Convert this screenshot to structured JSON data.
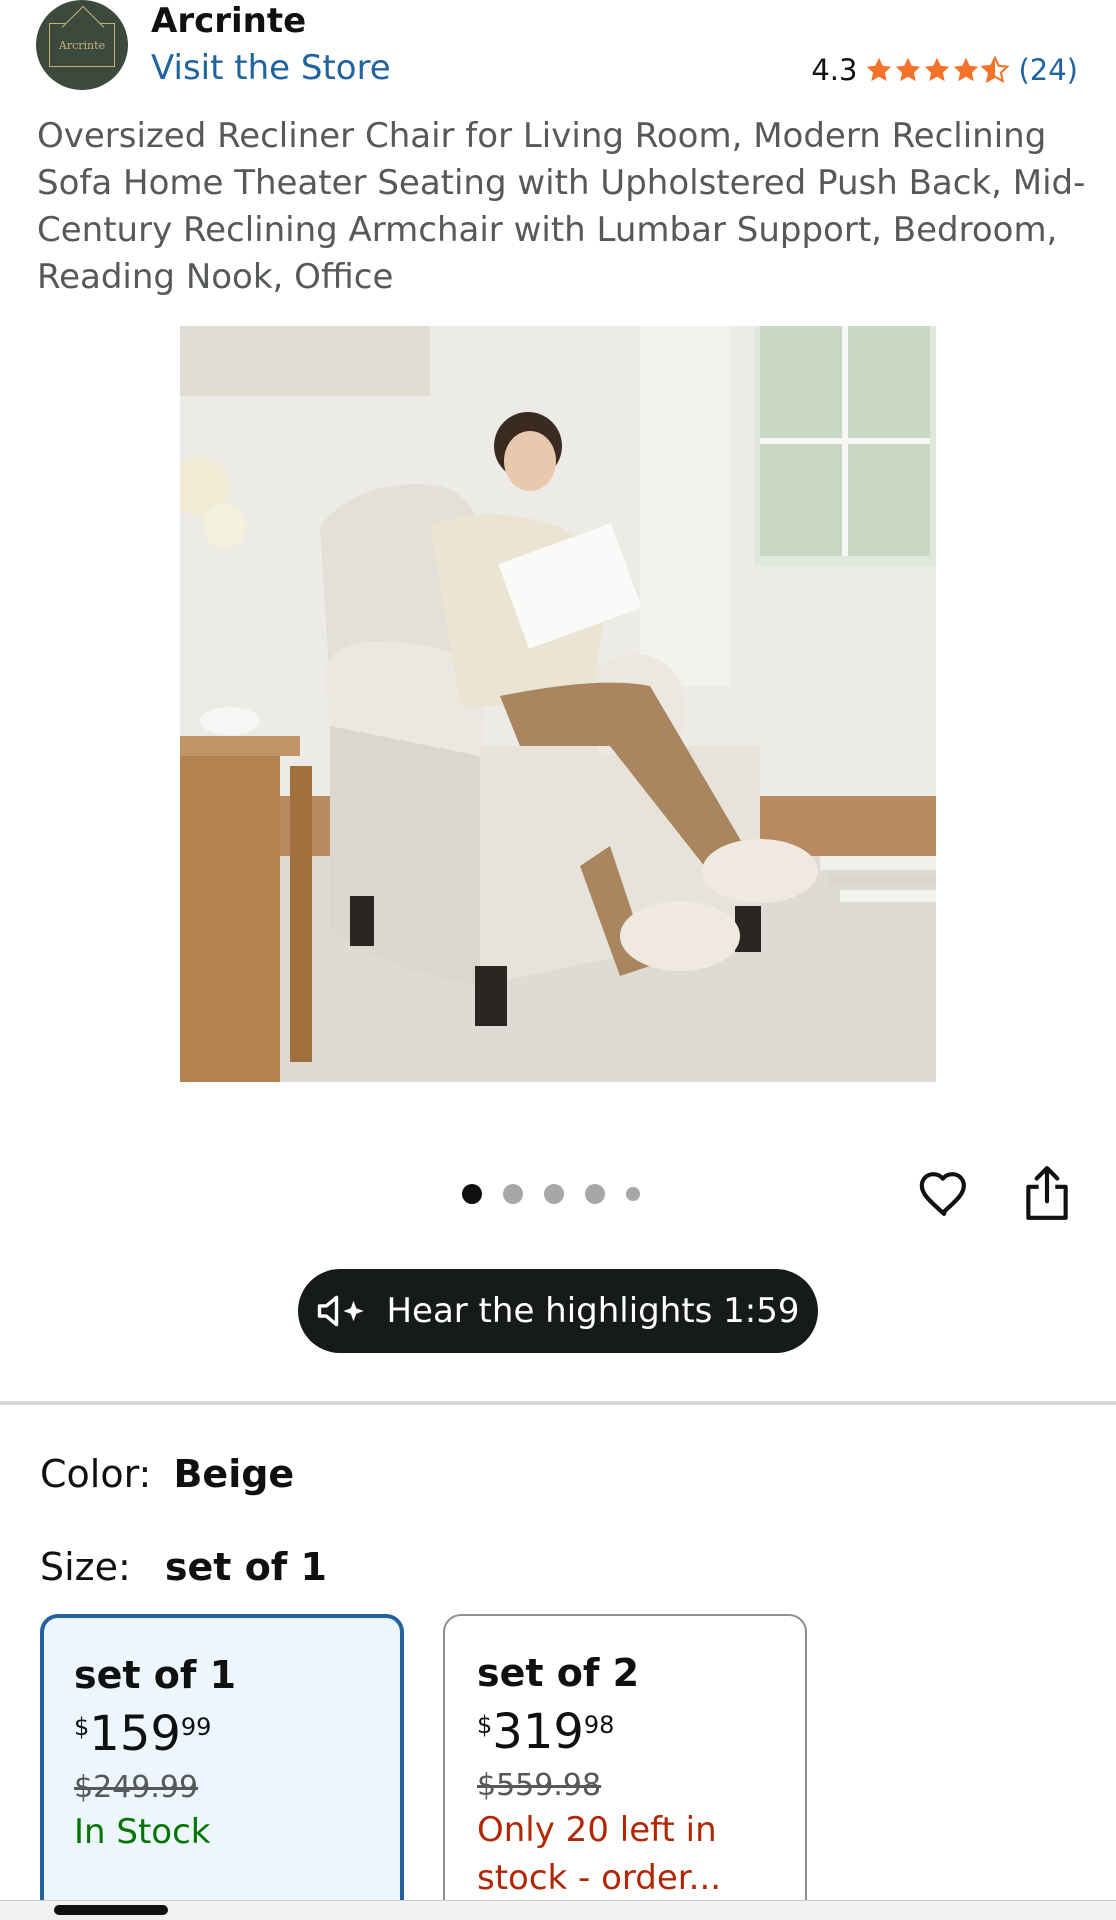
{
  "store": {
    "logo_text": "Arcrinte",
    "brand": "Arcrinte",
    "visit_link": "Visit the Store"
  },
  "rating": {
    "value": "4.3",
    "stars": 4.3,
    "count": "(24)",
    "star_color": "#f3732a"
  },
  "product": {
    "title": "Oversized Recliner Chair for Living Room, Modern Reclining Sofa Home Theater Seating with Upholstered Push Back, Mid-Century Reclining Armchair with Lumbar Support, Bedroom, Reading Nook, Office",
    "image_icon": "product-photo"
  },
  "gallery": {
    "total_dots": 5,
    "active_index": 0
  },
  "actions": {
    "favorite_icon": "heart-icon",
    "share_icon": "share-icon"
  },
  "audio": {
    "label": "Hear the highlights 1:59",
    "icon": "speaker-sparkle-icon"
  },
  "variations": {
    "color_label": "Color:",
    "color_value": "Beige",
    "size_label": "Size:",
    "size_value": "set of 1",
    "options": [
      {
        "title": "set of 1",
        "price_symbol": "$",
        "price_whole": "159",
        "price_fraction": "99",
        "was_price": "$249.99",
        "status": "In Stock"
      },
      {
        "title": "set of 2",
        "price_symbol": "$",
        "price_whole": "319",
        "price_fraction": "98",
        "was_price": "$559.98",
        "status": "Only 20 left in stock - order..."
      }
    ]
  },
  "colors": {
    "link": "#2162a1",
    "in_stock": "#007600",
    "low_stock": "#b12704",
    "selected_border": "#2162a1"
  }
}
